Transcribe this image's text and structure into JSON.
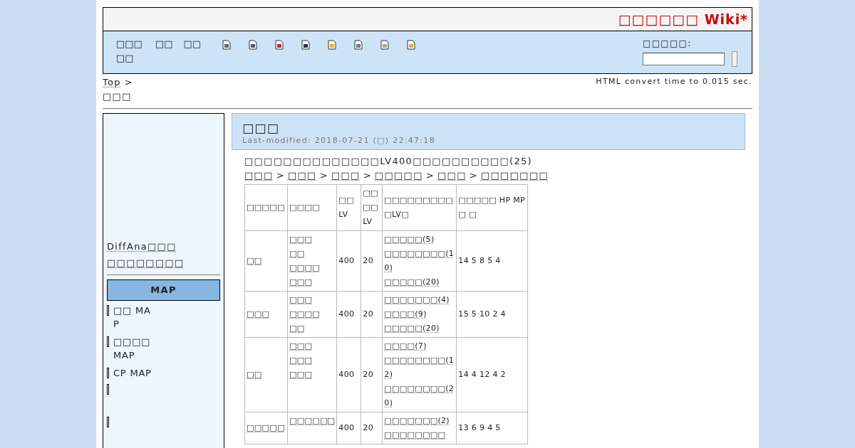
{
  "site_title": "□□□□□□ Wiki*",
  "nav": {
    "items": [
      "□□□□□",
      "□□",
      "□□"
    ],
    "search_label": "□□□□□:"
  },
  "breadcrumb": {
    "top": "Top",
    "separator": ">",
    "current": "□□□"
  },
  "convert_time": "HTML convert time to 0.015 sec.",
  "sidebar": {
    "links": [
      "DiffAna□□□",
      "□□□□□□□□"
    ],
    "menu_title": "MAP",
    "items": [
      {
        "kind": "link",
        "label": "□□ MAP"
      },
      {
        "kind": "link",
        "label": "□□□□ MAP"
      },
      {
        "kind": "link",
        "label": "CP MAP"
      },
      {
        "kind": "blank"
      },
      {
        "kind": "blank"
      }
    ]
  },
  "page": {
    "title": "□□□",
    "last_modified": "Last-modified: 2018-07-21 (□) 22:47:18",
    "intro": "□□□□□□□□□□□□□□LV400□□□□□□□□□□(25)",
    "path": [
      "□□□",
      "□□□",
      "□□□",
      "□□□□□",
      "□□□",
      "□□□□□□□"
    ],
    "path_separator": ">",
    "table": {
      "columns": [
        "□□□□□",
        "□□□□",
        "□□ LV",
        "□□□□LV",
        "□□□□□□□□□□LV□",
        "□□□□□ HP MP □ □"
      ],
      "rows": [
        {
          "name": "□□",
          "items": [
            "□□□",
            "□□",
            "□□□□",
            "□□□"
          ],
          "lv": "400",
          "cap": "20",
          "skills": [
            "□□□□□(5)",
            "□□□□□□□□(10)",
            "□□□□□(20)"
          ],
          "stats": "14 5 8 5 4"
        },
        {
          "name": "□□□",
          "items": [
            "□□□",
            "□□□□",
            "□□"
          ],
          "lv": "400",
          "cap": "20",
          "skills": [
            "□□□□□□□(4)",
            "□□□□(9)",
            "□□□□□(20)"
          ],
          "stats": "15 5 10 2 4"
        },
        {
          "name": "□□",
          "items": [
            "□□□",
            "□□□",
            "□□□"
          ],
          "lv": "400",
          "cap": "20",
          "skills": [
            "□□□□(7)",
            "□□□□□□□□(12)",
            "□□□□□□□□(20)"
          ],
          "stats": "14 4 12 4 2"
        },
        {
          "name": "□□□□□",
          "items": [
            "□□□□□□"
          ],
          "lv": "400",
          "cap": "20",
          "skills": [
            "□□□□□□□(2)",
            "□□□□□□□□"
          ],
          "stats": "13 6 9 4 5"
        }
      ]
    }
  }
}
